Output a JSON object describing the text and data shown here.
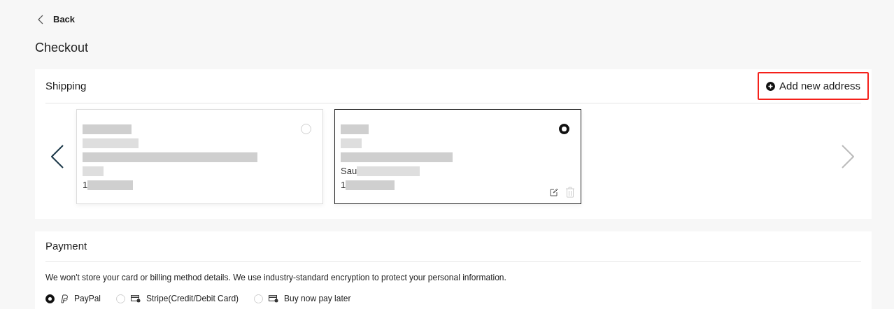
{
  "back": {
    "label": "Back"
  },
  "title": "Checkout",
  "shipping": {
    "title": "Shipping",
    "add_button": {
      "label": "Add new address",
      "highlighted": true
    },
    "addresses": [
      {
        "selected": false,
        "lines": [
          "1"
        ]
      },
      {
        "selected": true,
        "lines": [
          "Sau",
          "1"
        ]
      }
    ]
  },
  "payment": {
    "title": "Payment",
    "notice": "We won't store your card or billing method details. We use industry-standard encryption to protect your personal information.",
    "methods": [
      {
        "label": "PayPal",
        "kind": "paypal",
        "selected": true
      },
      {
        "label": "Stripe(Credit/Debit Card)",
        "kind": "card",
        "selected": false
      },
      {
        "label": "Buy now pay later",
        "kind": "card",
        "selected": false
      }
    ]
  }
}
